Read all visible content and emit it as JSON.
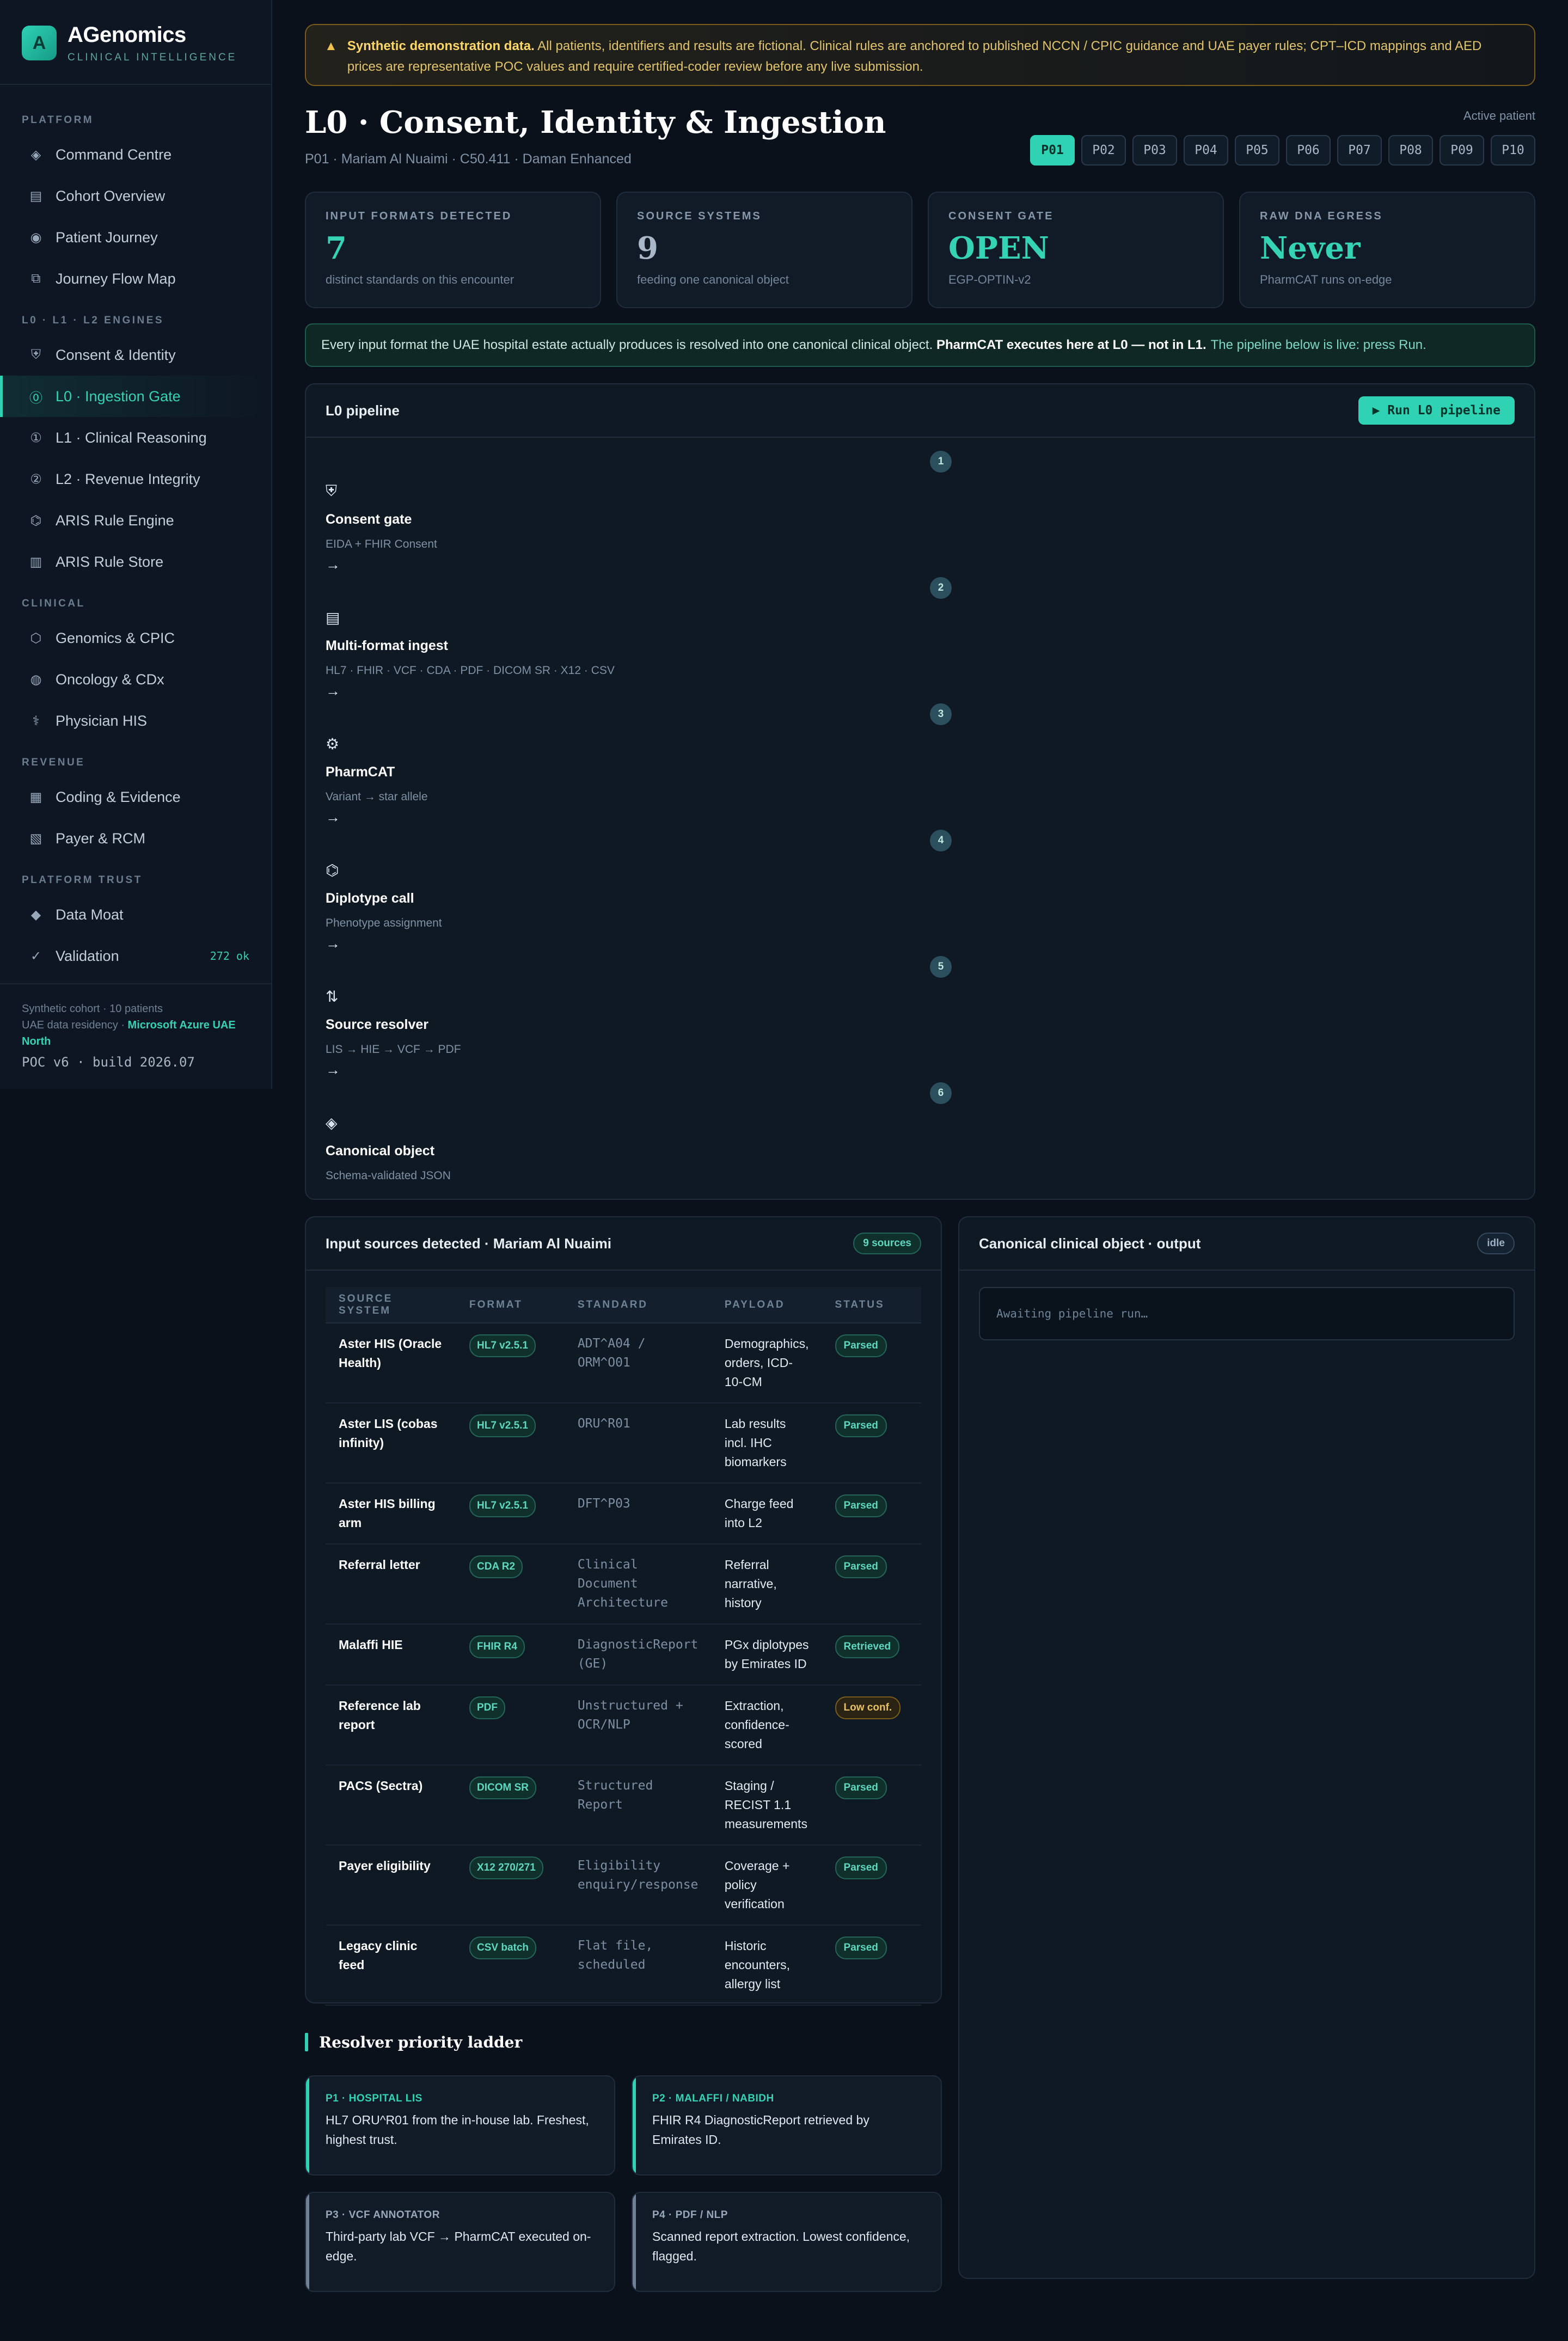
{
  "app": {
    "name": "AGenomics",
    "subtitle": "CLINICAL INTELLIGENCE",
    "logo_letter": "A"
  },
  "sidebar": {
    "sections": [
      {
        "label": "PLATFORM",
        "items": [
          {
            "label": "Command Centre",
            "icon": "diamond-icon"
          },
          {
            "label": "Cohort Overview",
            "icon": "grid-icon"
          },
          {
            "label": "Patient Journey",
            "icon": "target-icon"
          },
          {
            "label": "Journey Flow Map",
            "icon": "copy-icon"
          }
        ]
      },
      {
        "label": "L0 · L1 · L2 ENGINES",
        "items": [
          {
            "label": "Consent & Identity",
            "icon": "shield-icon"
          },
          {
            "label": "L0 · Ingestion Gate",
            "icon": "zero-circle-icon",
            "active": true
          },
          {
            "label": "L1 · Clinical Reasoning",
            "icon": "one-circle-icon"
          },
          {
            "label": "L2 · Revenue Integrity",
            "icon": "two-circle-icon"
          },
          {
            "label": "ARIS Rule Engine",
            "icon": "hexagon-icon"
          },
          {
            "label": "ARIS Rule Store",
            "icon": "table-icon"
          }
        ]
      },
      {
        "label": "CLINICAL",
        "items": [
          {
            "label": "Genomics & CPIC",
            "icon": "hexagon-outline-icon"
          },
          {
            "label": "Oncology & CDx",
            "icon": "circle-dot-icon"
          },
          {
            "label": "Physician HIS",
            "icon": "caduceus-icon"
          }
        ]
      },
      {
        "label": "REVENUE",
        "items": [
          {
            "label": "Coding & Evidence",
            "icon": "square-icon"
          },
          {
            "label": "Payer & RCM",
            "icon": "receipt-icon"
          }
        ]
      },
      {
        "label": "PLATFORM TRUST",
        "items": [
          {
            "label": "Data Moat",
            "icon": "gem-icon"
          },
          {
            "label": "Validation",
            "icon": "check-icon",
            "badge": "272 ok"
          }
        ]
      }
    ],
    "footer": {
      "cohort": "Synthetic cohort · 10 patients",
      "residency_label": "UAE data residency · ",
      "residency_value": "Microsoft Azure UAE North",
      "build": "POC v6 · build 2026.07"
    }
  },
  "banner": {
    "bold": "Synthetic demonstration data.",
    "text": " All patients, identifiers and results are fictional. Clinical rules are anchored to published NCCN / CPIC guidance and UAE payer rules; CPT–ICD mappings and AED prices are representative POC values and require certified-coder review before any live submission."
  },
  "header": {
    "title": "L0 · Consent, Identity & Ingestion",
    "subtitle": "P01 · Mariam Al Nuaimi · C50.411 · Daman Enhanced",
    "active_label": "Active patient",
    "patients": [
      "P01",
      "P02",
      "P03",
      "P04",
      "P05",
      "P06",
      "P07",
      "P08",
      "P09",
      "P10"
    ],
    "active_patient": "P01"
  },
  "stats": [
    {
      "label": "INPUT FORMATS DETECTED",
      "value": "7",
      "note": "distinct standards on this encounter",
      "color": "teal"
    },
    {
      "label": "SOURCE SYSTEMS",
      "value": "9",
      "note": "feeding one canonical object",
      "color": "grey"
    },
    {
      "label": "CONSENT GATE",
      "value": "OPEN",
      "note": "EGP-OPTIN-v2",
      "color": "teal"
    },
    {
      "label": "RAW DNA EGRESS",
      "value": "Never",
      "note": "PharmCAT runs on-edge",
      "color": "teal"
    }
  ],
  "info_bar": {
    "text": "Every input format the UAE hospital estate actually produces is resolved into one canonical clinical object. ",
    "bold": "PharmCAT executes here at L0 — not in L1.",
    "tail": "The pipeline below is live: press Run."
  },
  "pipeline": {
    "title": "L0 pipeline",
    "run_label": "▶ Run L0 pipeline",
    "steps": [
      {
        "num": "1",
        "icon": "shield-icon",
        "glyph": "⛨",
        "title": "Consent gate",
        "desc": "EIDA + FHIR Consent",
        "arrow": "→"
      },
      {
        "num": "2",
        "icon": "grid-icon",
        "glyph": "▤",
        "title": "Multi-format ingest",
        "desc": "HL7 · FHIR · VCF · CDA · PDF · DICOM SR · X12 · CSV",
        "arrow": "→"
      },
      {
        "num": "3",
        "icon": "gear-icon",
        "glyph": "⚙",
        "title": "PharmCAT",
        "desc": "Variant → star allele",
        "arrow": "→"
      },
      {
        "num": "4",
        "icon": "hexagon-icon",
        "glyph": "⌬",
        "title": "Diplotype call",
        "desc": "Phenotype assignment",
        "arrow": "→"
      },
      {
        "num": "5",
        "icon": "swap-icon",
        "glyph": "⇅",
        "title": "Source resolver",
        "desc": "LIS → HIE → VCF → PDF",
        "arrow": "→"
      },
      {
        "num": "6",
        "icon": "diamond-icon",
        "glyph": "◈",
        "title": "Canonical object",
        "desc": "Schema-validated JSON",
        "arrow": ""
      }
    ]
  },
  "sources": {
    "title": "Input sources detected · Mariam Al Nuaimi",
    "count": "9 sources",
    "columns": [
      "SOURCE SYSTEM",
      "FORMAT",
      "STANDARD",
      "PAYLOAD",
      "STATUS"
    ],
    "rows": [
      {
        "system": "Aster HIS (Oracle Health)",
        "format": "HL7 v2.5.1",
        "standard": "ADT^A04 / ORM^O01",
        "payload": "Demographics, orders, ICD-10-CM",
        "status": "Parsed"
      },
      {
        "system": "Aster LIS (cobas infinity)",
        "format": "HL7 v2.5.1",
        "standard": "ORU^R01",
        "payload": "Lab results incl. IHC biomarkers",
        "status": "Parsed"
      },
      {
        "system": "Aster HIS billing arm",
        "format": "HL7 v2.5.1",
        "standard": "DFT^P03",
        "payload": "Charge feed into L2",
        "status": "Parsed"
      },
      {
        "system": "Referral letter",
        "format": "CDA R2",
        "standard": "Clinical Document Architecture",
        "payload": "Referral narrative, history",
        "status": "Parsed"
      },
      {
        "system": "Malaffi HIE",
        "format": "FHIR R4",
        "standard": "DiagnosticReport (GE)",
        "payload": "PGx diplotypes by Emirates ID",
        "status": "Retrieved"
      },
      {
        "system": "Reference lab report",
        "format": "PDF",
        "standard": "Unstructured + OCR/NLP",
        "payload": "Extraction, confidence-scored",
        "status": "Low conf."
      },
      {
        "system": "PACS (Sectra)",
        "format": "DICOM SR",
        "standard": "Structured Report",
        "payload": "Staging / RECIST 1.1 measurements",
        "status": "Parsed"
      },
      {
        "system": "Payer eligibility",
        "format": "X12 270/271",
        "standard": "Eligibility enquiry/response",
        "payload": "Coverage + policy verification",
        "status": "Parsed"
      },
      {
        "system": "Legacy clinic feed",
        "format": "CSV batch",
        "standard": "Flat file, scheduled",
        "payload": "Historic encounters, allergy list",
        "status": "Parsed"
      }
    ]
  },
  "ladder": {
    "title": "Resolver priority ladder",
    "cards": [
      {
        "tag": "P1 · HOSPITAL LIS",
        "text": "HL7 ORU^R01 from the in-house lab. Freshest, highest trust.",
        "tone": "teal"
      },
      {
        "tag": "P2 · MALAFFI / NABIDH",
        "text": "FHIR R4 DiagnosticReport retrieved by Emirates ID.",
        "tone": "teal"
      },
      {
        "tag": "P3 · VCF ANNOTATOR",
        "text": "Third-party lab VCF → PharmCAT executed on-edge.",
        "tone": "grey"
      },
      {
        "tag": "P4 · PDF / NLP",
        "text": "Scanned report extraction. Lowest confidence, flagged.",
        "tone": "grey"
      }
    ]
  },
  "output": {
    "title": "Canonical clinical object · output",
    "state": "idle",
    "placeholder": "Awaiting pipeline run…"
  },
  "colors": {
    "accent": "#2fd3b4",
    "background": "#0a111b",
    "warning": "#e7c063"
  }
}
